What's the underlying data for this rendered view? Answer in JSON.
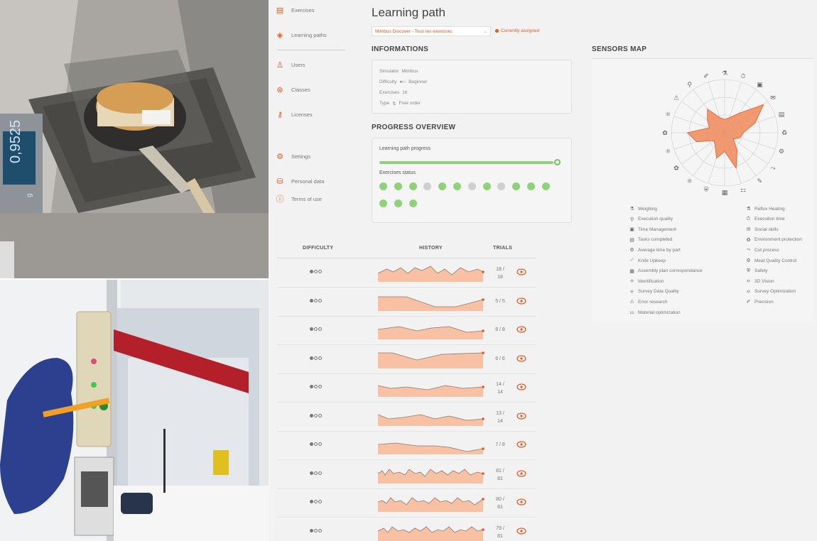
{
  "balance_display": "0,9525",
  "balance_unit": "g",
  "sidebar": {
    "items": [
      {
        "label": "Exercises",
        "icon": "document-icon"
      },
      {
        "label": "Learning paths",
        "icon": "tag-icon"
      },
      {
        "label": "Users",
        "icon": "user-icon"
      },
      {
        "label": "Classes",
        "icon": "group-icon"
      },
      {
        "label": "Licenses",
        "icon": "key-icon"
      },
      {
        "label": "Settings",
        "icon": "gear-icon"
      },
      {
        "label": "Personal data",
        "icon": "database-icon"
      },
      {
        "label": "Terms of use",
        "icon": "info-icon"
      }
    ]
  },
  "page": {
    "title": "Learning path",
    "path_select": "Mimbus Discover - Tous les exercices",
    "assigned_label": "Currently assigned"
  },
  "informations": {
    "heading": "INFORMATIONS",
    "rows": [
      {
        "key": "Simulator",
        "value": "Mimbus"
      },
      {
        "key": "Difficulty",
        "value": "Beginner"
      },
      {
        "key": "Exercises",
        "value": "16"
      },
      {
        "key": "Type",
        "value": "Free order"
      }
    ]
  },
  "progress": {
    "heading": "PROGRESS OVERVIEW",
    "path_progress_label": "Learning path progress",
    "path_progress_value": 1.0,
    "status_label": "Exercises status",
    "status": [
      "done",
      "done",
      "done",
      "todo",
      "done",
      "done",
      "todo",
      "done",
      "todo",
      "done",
      "done",
      "done",
      "done",
      "done",
      "done"
    ]
  },
  "table": {
    "headers": {
      "difficulty": "DIFFICULTY",
      "history": "HISTORY",
      "trials": "TRIALS"
    },
    "rows": [
      {
        "trials_a": "18 /",
        "trials_b": "18"
      },
      {
        "trials_a": "5 / 5",
        "trials_b": ""
      },
      {
        "trials_a": "8 / 8",
        "trials_b": ""
      },
      {
        "trials_a": "6 / 6",
        "trials_b": ""
      },
      {
        "trials_a": "14 /",
        "trials_b": "14"
      },
      {
        "trials_a": "13 /",
        "trials_b": "14"
      },
      {
        "trials_a": "7 / 8",
        "trials_b": ""
      },
      {
        "trials_a": "81 /",
        "trials_b": "81"
      },
      {
        "trials_a": "80 /",
        "trials_b": "81"
      },
      {
        "trials_a": "79 /",
        "trials_b": "81"
      }
    ]
  },
  "sensors": {
    "heading": "SENSORS MAP",
    "legend_left": [
      "Weighing",
      "Execution quality",
      "Time Management",
      "Tasks completed",
      "Average time by part",
      "Knife Upkeep",
      "Assembly plan correspondance",
      "Identification",
      "Survey Data Quality",
      "Error research",
      "Material optimization"
    ],
    "legend_right": [
      "Reflux Heating",
      "Execution time",
      "Social skills",
      "Environment protection",
      "Cut process",
      "Meat Quality Control",
      "Safety",
      "3D Vision",
      "Survey Optimization",
      "Precision"
    ]
  },
  "colors": {
    "accent": "#e8571e",
    "green": "#6fc35a",
    "radar_fill": "#f08a5a"
  }
}
